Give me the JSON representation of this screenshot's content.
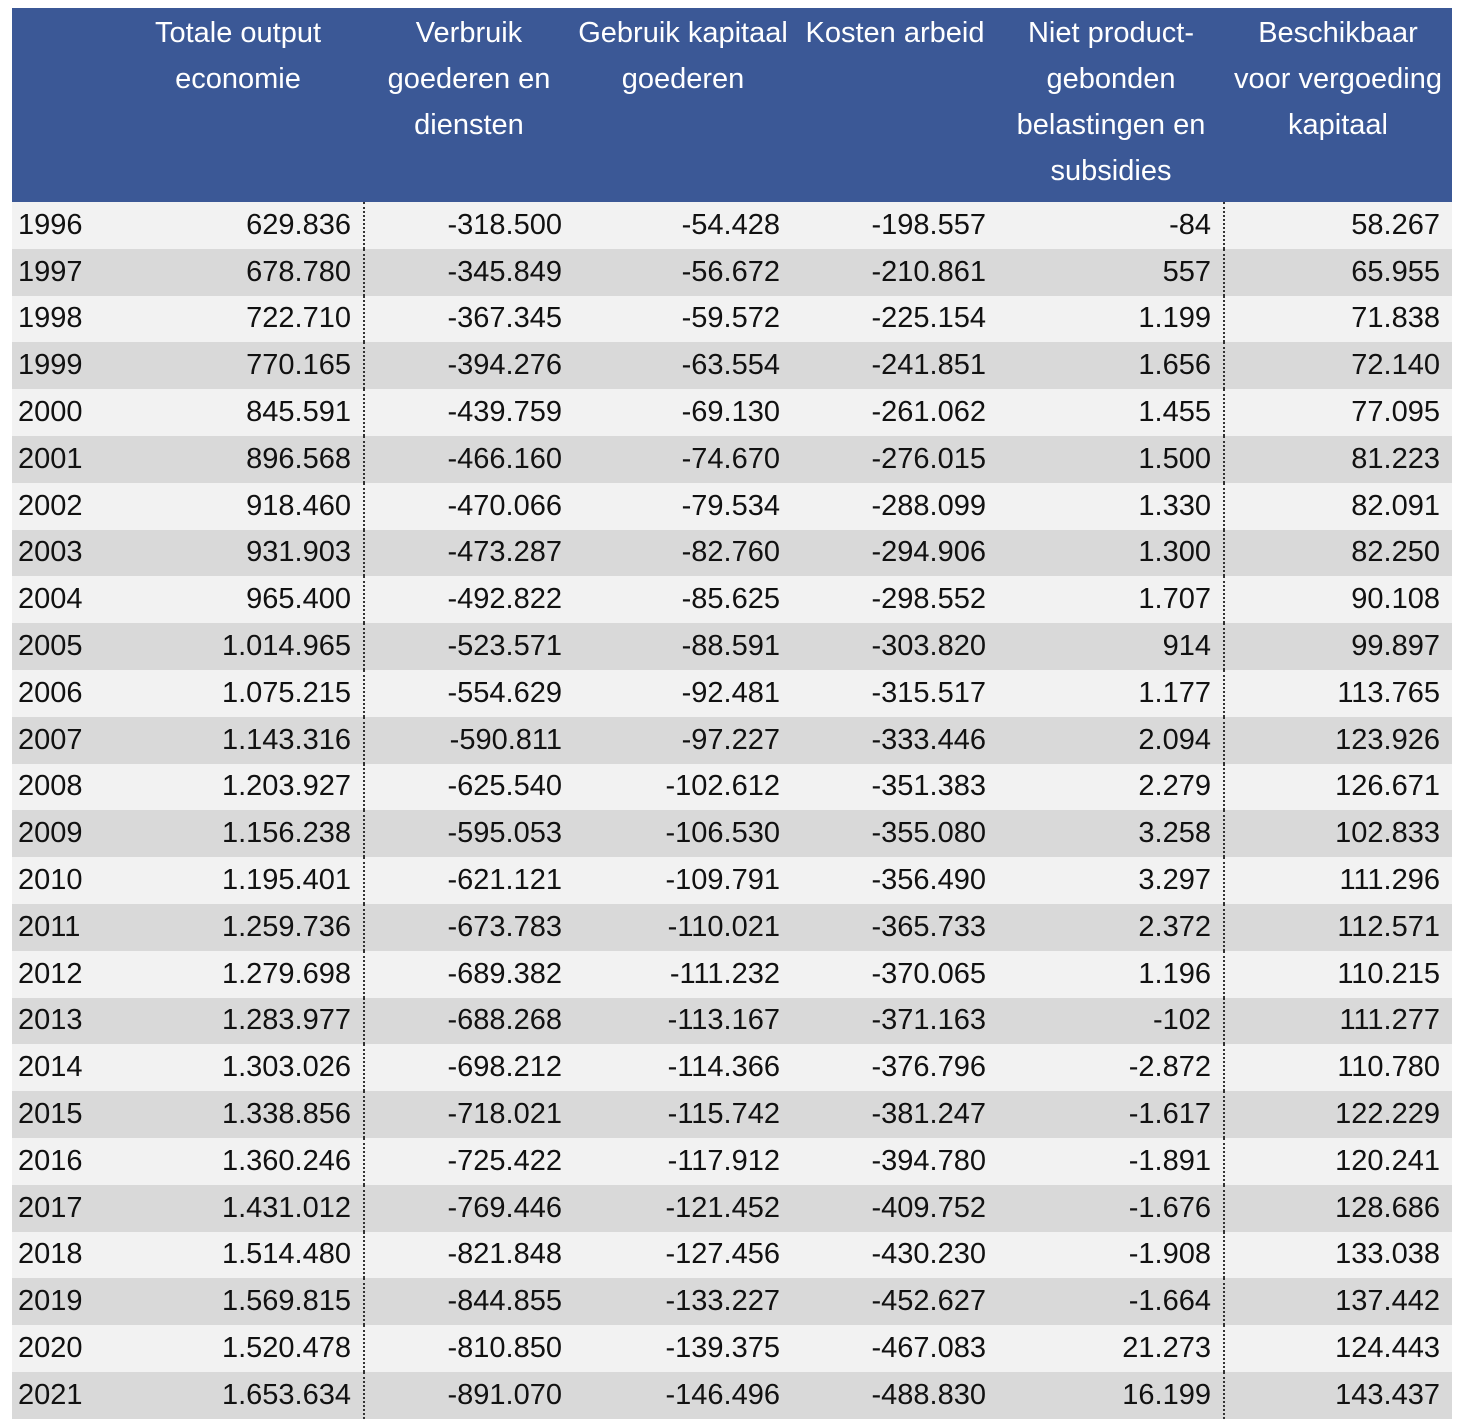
{
  "table": {
    "headers": [
      "",
      "Totale output economie",
      "Verbruik goederen en diensten",
      "Gebruik kapitaal goederen",
      "Kosten arbeid",
      "Niet product-gebonden belastingen en subsidies",
      "Beschikbaar voor vergoeding kapitaal"
    ],
    "rows": [
      [
        "1996",
        "629.836",
        "-318.500",
        "-54.428",
        "-198.557",
        "-84",
        "58.267"
      ],
      [
        "1997",
        "678.780",
        "-345.849",
        "-56.672",
        "-210.861",
        "557",
        "65.955"
      ],
      [
        "1998",
        "722.710",
        "-367.345",
        "-59.572",
        "-225.154",
        "1.199",
        "71.838"
      ],
      [
        "1999",
        "770.165",
        "-394.276",
        "-63.554",
        "-241.851",
        "1.656",
        "72.140"
      ],
      [
        "2000",
        "845.591",
        "-439.759",
        "-69.130",
        "-261.062",
        "1.455",
        "77.095"
      ],
      [
        "2001",
        "896.568",
        "-466.160",
        "-74.670",
        "-276.015",
        "1.500",
        "81.223"
      ],
      [
        "2002",
        "918.460",
        "-470.066",
        "-79.534",
        "-288.099",
        "1.330",
        "82.091"
      ],
      [
        "2003",
        "931.903",
        "-473.287",
        "-82.760",
        "-294.906",
        "1.300",
        "82.250"
      ],
      [
        "2004",
        "965.400",
        "-492.822",
        "-85.625",
        "-298.552",
        "1.707",
        "90.108"
      ],
      [
        "2005",
        "1.014.965",
        "-523.571",
        "-88.591",
        "-303.820",
        "914",
        "99.897"
      ],
      [
        "2006",
        "1.075.215",
        "-554.629",
        "-92.481",
        "-315.517",
        "1.177",
        "113.765"
      ],
      [
        "2007",
        "1.143.316",
        "-590.811",
        "-97.227",
        "-333.446",
        "2.094",
        "123.926"
      ],
      [
        "2008",
        "1.203.927",
        "-625.540",
        "-102.612",
        "-351.383",
        "2.279",
        "126.671"
      ],
      [
        "2009",
        "1.156.238",
        "-595.053",
        "-106.530",
        "-355.080",
        "3.258",
        "102.833"
      ],
      [
        "2010",
        "1.195.401",
        "-621.121",
        "-109.791",
        "-356.490",
        "3.297",
        "111.296"
      ],
      [
        "2011",
        "1.259.736",
        "-673.783",
        "-110.021",
        "-365.733",
        "2.372",
        "112.571"
      ],
      [
        "2012",
        "1.279.698",
        "-689.382",
        "-111.232",
        "-370.065",
        "1.196",
        "110.215"
      ],
      [
        "2013",
        "1.283.977",
        "-688.268",
        "-113.167",
        "-371.163",
        "-102",
        "111.277"
      ],
      [
        "2014",
        "1.303.026",
        "-698.212",
        "-114.366",
        "-376.796",
        "-2.872",
        "110.780"
      ],
      [
        "2015",
        "1.338.856",
        "-718.021",
        "-115.742",
        "-381.247",
        "-1.617",
        "122.229"
      ],
      [
        "2016",
        "1.360.246",
        "-725.422",
        "-117.912",
        "-394.780",
        "-1.891",
        "120.241"
      ],
      [
        "2017",
        "1.431.012",
        "-769.446",
        "-121.452",
        "-409.752",
        "-1.676",
        "128.686"
      ],
      [
        "2018",
        "1.514.480",
        "-821.848",
        "-127.456",
        "-430.230",
        "-1.908",
        "133.038"
      ],
      [
        "2019",
        "1.569.815",
        "-844.855",
        "-133.227",
        "-452.627",
        "-1.664",
        "137.442"
      ],
      [
        "2020",
        "1.520.478",
        "-810.850",
        "-139.375",
        "-467.083",
        "21.273",
        "124.443"
      ],
      [
        "2021",
        "1.653.634",
        "-891.070",
        "-146.496",
        "-488.830",
        "16.199",
        "143.437"
      ]
    ]
  },
  "colors": {
    "header_bg": "#3b5896",
    "header_text": "#ffffff",
    "row_light": "#f2f2f2",
    "row_dark": "#d9d9d9"
  }
}
